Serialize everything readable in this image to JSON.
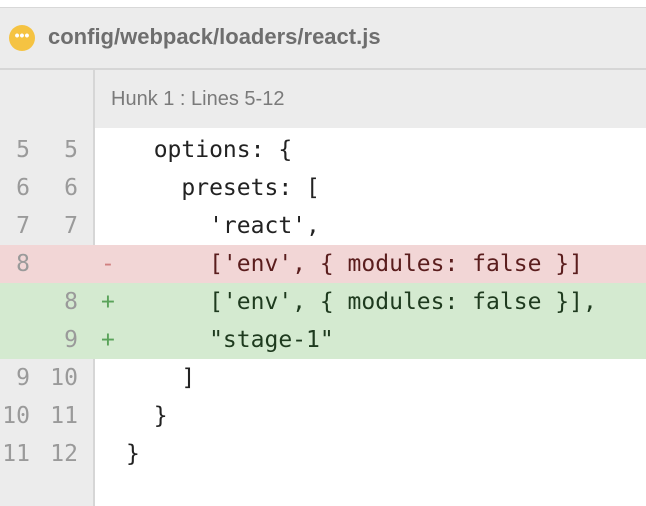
{
  "file": {
    "status_icon": "ellipsis-icon",
    "status_color": "#f5c342",
    "path": "config/webpack/loaders/react.js"
  },
  "hunk": {
    "title": "Hunk 1 : Lines 5-12"
  },
  "lines": [
    {
      "old": "5",
      "new": "5",
      "type": "context",
      "marker": "",
      "code": "  options: {"
    },
    {
      "old": "6",
      "new": "6",
      "type": "context",
      "marker": "",
      "code": "    presets: ["
    },
    {
      "old": "7",
      "new": "7",
      "type": "context",
      "marker": "",
      "code": "      'react',"
    },
    {
      "old": "8",
      "new": "",
      "type": "del",
      "marker": "-",
      "code": "      ['env', { modules: false }]"
    },
    {
      "old": "",
      "new": "8",
      "type": "add",
      "marker": "+",
      "code": "      ['env', { modules: false }],"
    },
    {
      "old": "",
      "new": "9",
      "type": "add",
      "marker": "+",
      "code": "      \"stage-1\""
    },
    {
      "old": "9",
      "new": "10",
      "type": "context",
      "marker": "",
      "code": "    ]"
    },
    {
      "old": "10",
      "new": "11",
      "type": "context",
      "marker": "",
      "code": "  }"
    },
    {
      "old": "11",
      "new": "12",
      "type": "context",
      "marker": "",
      "code": "}"
    }
  ],
  "colors": {
    "deleted_bg": "#f2d6d6",
    "added_bg": "#d4ead0"
  }
}
